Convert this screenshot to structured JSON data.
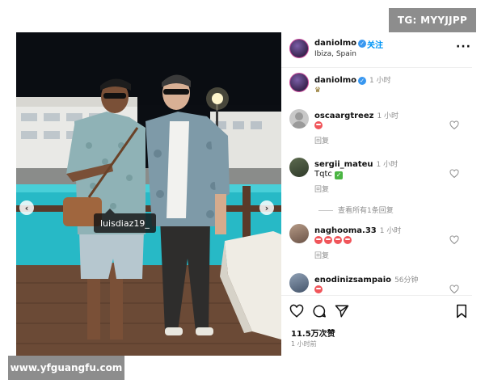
{
  "watermarks": {
    "top_right": "TG: MYYJJPP",
    "bottom_left": "www.yfguangfu.com"
  },
  "post": {
    "author": "daniolmo",
    "follow_label": "关注",
    "location": "Ibiza, Spain",
    "more_icon": "more-dots-icon",
    "photo_tag": "luisdiaz19_",
    "caption": {
      "username": "daniolmo",
      "time": "1 小时",
      "text_icon": "trophy-emoji"
    },
    "comments": [
      {
        "username": "oscaargtreez",
        "time": "1 小时",
        "text": "",
        "emoji": "smiling-face-emoji",
        "reply": "回复"
      },
      {
        "username": "sergii_mateu",
        "time": "1 小时",
        "text": "Tqtc",
        "emoji": "check-mark-emoji",
        "reply": "回复"
      },
      {
        "username": "naghooma.33",
        "time": "1 小时",
        "text": "",
        "emoji": "smiling-face-emoji",
        "emoji_count": 4,
        "reply": "回复"
      },
      {
        "username": "enodinizsampaio",
        "time": "56分钟",
        "text": "",
        "emoji": "smiling-face-emoji",
        "reply": ""
      }
    ],
    "view_replies": "查看所有1条回复",
    "likes": "11.5万次赞",
    "posted": "1 小时前"
  },
  "colors": {
    "link_blue": "#0095f6",
    "verified_blue": "#3897f0",
    "watermark_gray": "#8d8d8d"
  }
}
